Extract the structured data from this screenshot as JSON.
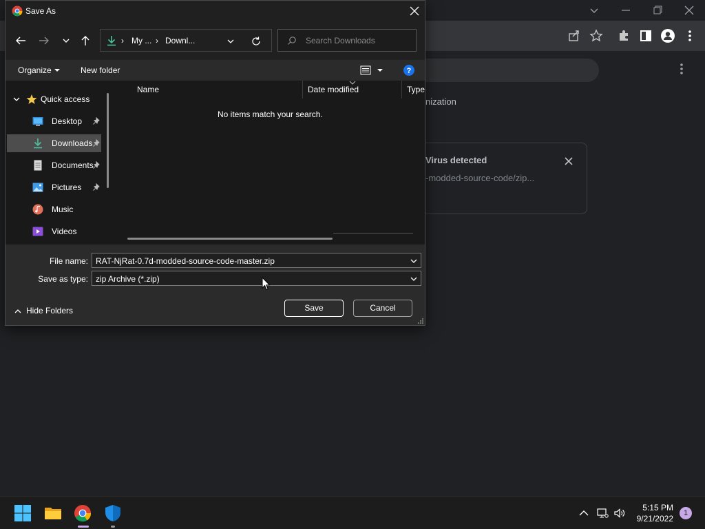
{
  "dialog": {
    "title": "Save As",
    "breadcrumb": [
      "My ...",
      "Downl..."
    ],
    "search_placeholder": "Search Downloads",
    "organize_label": "Organize",
    "new_folder_label": "New folder",
    "nav_items": [
      {
        "label": "Quick access",
        "icon": "star-icon"
      },
      {
        "label": "Desktop",
        "icon": "desktop-icon",
        "pinned": true
      },
      {
        "label": "Downloads",
        "icon": "download-icon",
        "pinned": true,
        "selected": true
      },
      {
        "label": "Documents",
        "icon": "documents-icon",
        "pinned": true
      },
      {
        "label": "Pictures",
        "icon": "pictures-icon",
        "pinned": true
      },
      {
        "label": "Music",
        "icon": "music-icon"
      },
      {
        "label": "Videos",
        "icon": "videos-icon"
      }
    ],
    "columns": [
      "Name",
      "Date modified",
      "Type"
    ],
    "empty_message": "No items match your search.",
    "file_name_label": "File name:",
    "file_name_value": "RAT-NjRat-0.7d-modded-source-code-master.zip",
    "save_type_label": "Save as type:",
    "save_type_value": "zip Archive (*.zip)",
    "hide_folders_label": "Hide Folders",
    "save_button": "Save",
    "cancel_button": "Cancel"
  },
  "browser": {
    "organization_fragment": "nization",
    "warning_title": "Virus detected",
    "warning_file": "-modded-source-code/zip..."
  },
  "taskbar": {
    "time": "5:15 PM",
    "date": "9/21/2022",
    "notification_count": "1"
  },
  "colors": {
    "accent": "#0078d4",
    "download_green": "#4fc3a1",
    "dialog_bg": "#202020",
    "page_bg": "#202124"
  }
}
